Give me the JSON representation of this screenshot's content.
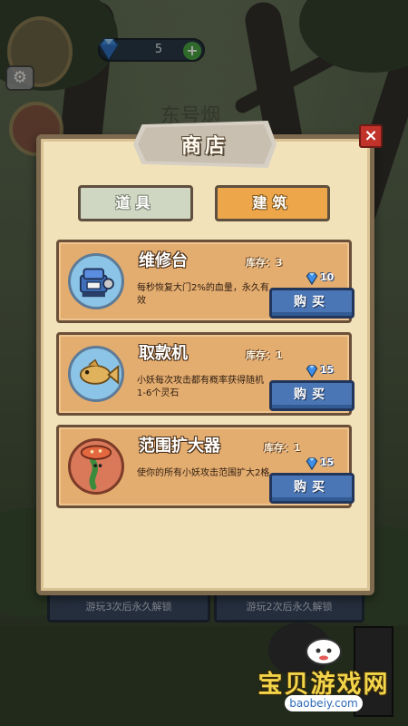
{
  "hud": {
    "gem_count": "5",
    "gem_plus": "+",
    "settings_icon": "gear-icon"
  },
  "background": {
    "sign_text": "东号烟",
    "bottom_buttons": [
      "游玩3次后永久解锁",
      "游玩2次后永久解锁"
    ]
  },
  "shop": {
    "title": "商店",
    "close_label": "×",
    "tabs": [
      {
        "label": "道具",
        "active": false
      },
      {
        "label": "建筑",
        "active": true
      }
    ],
    "items": [
      {
        "name": "维修台",
        "stock_label": "库存：3",
        "description": "每秒恢复大门2%的血量，永久有效",
        "price": "10",
        "buy_label": "购买",
        "icon": "repair-station-icon"
      },
      {
        "name": "取款机",
        "stock_label": "库存：1",
        "description": "小妖每次攻击都有概率获得随机1-6个灵石",
        "price": "15",
        "buy_label": "购买",
        "icon": "money-fish-icon"
      },
      {
        "name": "范围扩大器",
        "stock_label": "库存：1",
        "description": "使你的所有小妖攻击范围扩大2格",
        "price": "15",
        "buy_label": "购买",
        "icon": "range-expander-icon"
      }
    ]
  },
  "watermark": {
    "title": "宝贝游戏网",
    "url": "baobeiy.com"
  },
  "colors": {
    "panel_bg": "#f2e2b9",
    "card_bg": "#e4ad70",
    "buy_button": "#4a76b5",
    "active_tab": "#eda74a",
    "inactive_tab": "#cfd6c2",
    "close_button": "#c0322a",
    "gem": "#3d8ee8"
  }
}
